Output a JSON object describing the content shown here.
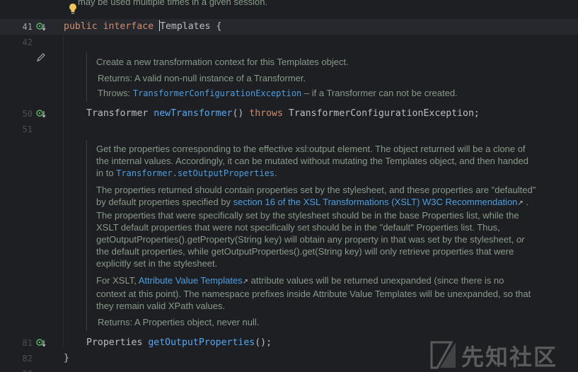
{
  "editor": {
    "top_doc_fragment": "may be used multiple times in a given session.",
    "gutter": {
      "lines": [
        "41",
        "42",
        "50",
        "51",
        "81",
        "82",
        "83"
      ]
    },
    "code": {
      "line41": {
        "kw1": "public",
        "kw2": "interface",
        "name": "Templates",
        "brace": "{"
      },
      "line50": {
        "type": "Transformer",
        "method": "newTransformer",
        "parens": "()",
        "kw": "throws",
        "exc": "TransformerConfigurationException;"
      },
      "line81": {
        "type": "Properties",
        "method": "getOutputProperties",
        "tail": "();"
      },
      "line82": {
        "brace": "}"
      }
    },
    "doc1": {
      "summary": "Create a new transformation context for this Templates object.",
      "returns_tag": "Returns:",
      "returns_text": "A valid non-null instance of a Transformer.",
      "throws_tag": "Throws:",
      "throws_link": "TransformerConfigurationException",
      "throws_text": " – if a Transformer can not be created."
    },
    "doc2": {
      "p1_a": "Get the properties corresponding to the effective xsl:output element. The object returned will be a clone of the internal values. Accordingly, it can be mutated without mutating the Templates object, and then handed in to ",
      "p1_link": "Transformer.setOutputProperties",
      "p1_b": ".",
      "p2_a": "The properties returned should contain properties set by the stylesheet, and these properties are \"defaulted\" by default properties specified by ",
      "p2_link": "section 16 of the XSL Transformations (XSLT) W3C Recommendation",
      "p2_b": " . The properties that were specifically set by the stylesheet should be in the base Properties list, while the XSLT default properties that were not specifically set should be in the \"default\" Properties list. Thus, getOutputProperties().getProperty(String key) will obtain any property in that was set by the stylesheet, ",
      "p2_or": "or",
      "p2_c": " the default properties, while getOutputProperties().get(String key) will only retrieve properties that were explicitly set in the stylesheet.",
      "p3_a": "For XSLT, ",
      "p3_link": "Attribute Value Templates",
      "p3_b": " attribute values will be returned unexpanded (since there is no context at this point). The namespace prefixes inside Attribute Value Templates will be unexpanded, so that they remain valid XPath values.",
      "returns_tag": "Returns:",
      "returns_text": "A Properties object, never null."
    },
    "watermark": "先知社区",
    "colors": {
      "background": "#1e1f22",
      "keyword": "#cf8e6d",
      "method": "#56a8f5",
      "doc_text": "#8a9a8a",
      "doc_link": "#4d9ee0"
    }
  }
}
